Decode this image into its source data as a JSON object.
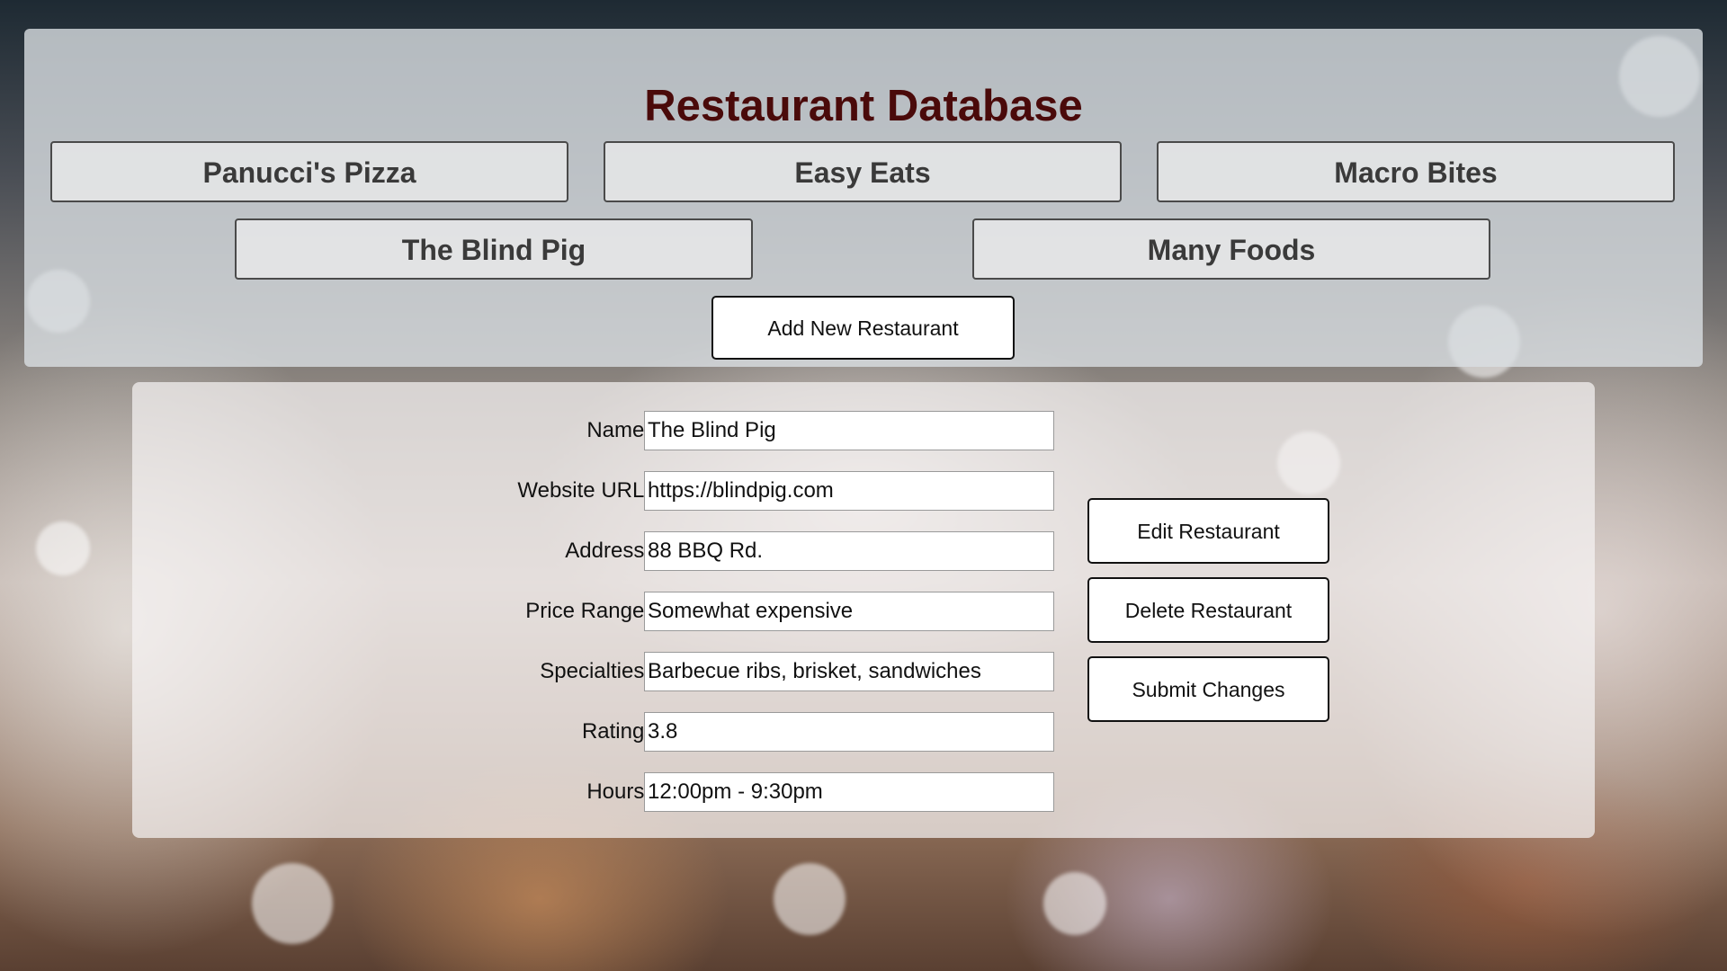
{
  "header": {
    "title": "Restaurant Database",
    "restaurants": [
      "Panucci's Pizza",
      "Easy Eats",
      "Macro Bites",
      "The Blind Pig",
      "Many Foods"
    ],
    "add_label": "Add New Restaurant"
  },
  "form": {
    "fields": [
      {
        "label": "Name:",
        "value": "The Blind Pig"
      },
      {
        "label": "Website URL:",
        "value": "https://blindpig.com"
      },
      {
        "label": "Address:",
        "value": "88 BBQ Rd."
      },
      {
        "label": "Price Range:",
        "value": "Somewhat expensive"
      },
      {
        "label": "Specialties:",
        "value": "Barbecue ribs, brisket, sandwiches"
      },
      {
        "label": "Rating:",
        "value": "3.8"
      },
      {
        "label": "Hours:",
        "value": "12:00pm - 9:30pm"
      }
    ],
    "actions": {
      "edit_label": "Edit Restaurant",
      "delete_label": "Delete Restaurant",
      "submit_label": "Submit Changes"
    }
  },
  "colors": {
    "title": "#4a0a0a",
    "button_border": "#111111",
    "panel_bg": "#dadee2"
  }
}
